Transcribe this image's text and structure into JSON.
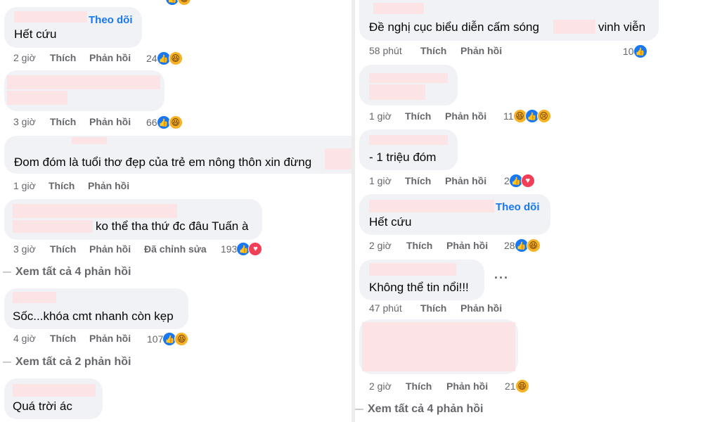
{
  "left": {
    "c1": {
      "follow": "Theo dõi",
      "text": "Hết cứu",
      "time": "2 giờ",
      "like": "Thích",
      "reply": "Phản hồi",
      "count": "24",
      "reactions": [
        "like-icon",
        "haha-icon"
      ]
    },
    "c2": {
      "time": "3 giờ",
      "like": "Thích",
      "reply": "Phản hồi",
      "count": "66",
      "reactions": [
        "like-icon",
        "haha-icon"
      ]
    },
    "c3": {
      "text": "Đom đóm là tuổi thơ đẹp của trẻ em nông thôn xin đừng",
      "time": "1 giờ",
      "like": "Thích",
      "reply": "Phản hồi"
    },
    "c4": {
      "text": "ko thể tha thứ đc đâu Tuấn à",
      "time": "3 giờ",
      "like": "Thích",
      "reply": "Phản hồi",
      "edited": "Đã chỉnh sửa",
      "count": "193",
      "reactions": [
        "like-icon",
        "love-icon"
      ]
    },
    "seeall1": "Xem tất cả 4 phản hồi",
    "c5": {
      "text": "Sốc...khóa cmt nhanh còn kẹp",
      "time": "4 giờ",
      "like": "Thích",
      "reply": "Phản hồi",
      "count": "107",
      "reactions": [
        "like-icon",
        "haha-icon"
      ]
    },
    "seeall2": "Xem tất cả 2 phản hồi",
    "c6": {
      "text": "Quá trời ác"
    }
  },
  "right": {
    "c1": {
      "text_a": "Đề nghị cục biểu diễn cấm sóng",
      "text_b": "vinh viễn",
      "time": "58 phút",
      "like": "Thích",
      "reply": "Phản hồi",
      "count": "10",
      "reactions": [
        "like-icon"
      ]
    },
    "c2": {
      "time": "1 giờ",
      "like": "Thích",
      "reply": "Phản hồi",
      "count": "11",
      "reactions": [
        "haha-icon",
        "like-icon",
        "sad-icon"
      ]
    },
    "c3": {
      "text": "- 1 triệu đóm",
      "time": "1 giờ",
      "like": "Thích",
      "reply": "Phản hồi",
      "count": "2",
      "reactions": [
        "like-icon",
        "love-icon"
      ]
    },
    "c4": {
      "follow": "Theo dõi",
      "text": "Hết cứu",
      "time": "2 giờ",
      "like": "Thích",
      "reply": "Phản hồi",
      "count": "28",
      "reactions": [
        "like-icon",
        "haha-icon"
      ]
    },
    "c5": {
      "text": "Không thể tin nổi!!!",
      "time": "47 phút",
      "like": "Thích",
      "reply": "Phản hồi",
      "more": "···"
    },
    "c6": {
      "time": "2 giờ",
      "like": "Thích",
      "reply": "Phản hồi",
      "count": "21",
      "reactions": [
        "haha-icon"
      ]
    },
    "seeall": "Xem tất cả 4 phản hồi"
  },
  "colors": {
    "bubble": "#f0f2f5",
    "redaction": "#fbe3e6",
    "link": "#1877f2",
    "meta": "#65676b"
  }
}
